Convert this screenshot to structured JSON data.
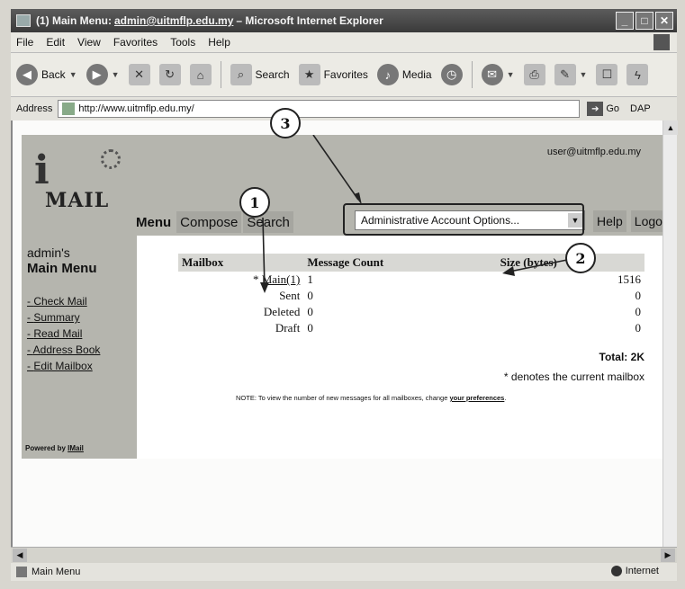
{
  "window": {
    "title_prefix": "(1) Main Menu: ",
    "title_email": "admin@uitmflp.edu.my",
    "title_suffix": "– Microsoft Internet Explorer"
  },
  "menubar": [
    "File",
    "Edit",
    "View",
    "Favorites",
    "Tools",
    "Help"
  ],
  "toolbar": {
    "back": "Back",
    "search": "Search",
    "favorites": "Favorites",
    "media": "Media"
  },
  "address": {
    "label": "Address",
    "url": "http://www.uitmflp.edu.my/",
    "go": "Go",
    "links": "DAP"
  },
  "mail": {
    "logo": "MAIL",
    "user_email": "user@uitmflp.edu.my",
    "tabs": [
      "Menu",
      "Compose",
      "Search"
    ],
    "account_select": "Administrative Account Options...",
    "help": "Help",
    "logout": "Logout",
    "sidebar": {
      "title_line1": "admin's",
      "title_line2": "Main Menu",
      "links": [
        "Check Mail",
        "Summary",
        "Read Mail",
        "Address Book",
        "Edit Mailbox"
      ],
      "powered_by_prefix": "Powered by ",
      "powered_by_link": "IMail"
    },
    "table": {
      "headers": [
        "Mailbox",
        "Message Count",
        "Size (bytes)"
      ],
      "rows": [
        {
          "mailbox": "Main(1)",
          "marker": "*",
          "count": "1",
          "size": "1516"
        },
        {
          "mailbox": "Sent",
          "marker": "",
          "count": "0",
          "size": "0"
        },
        {
          "mailbox": "Deleted",
          "marker": "",
          "count": "0",
          "size": "0"
        },
        {
          "mailbox": "Draft",
          "marker": "",
          "count": "0",
          "size": "0"
        }
      ]
    },
    "total_label": "Total:",
    "total_value": "2K",
    "denote": "* denotes the current mailbox",
    "note_text": "NOTE: To view the number of new messages for all mailboxes, change ",
    "note_link": "your preferences",
    "note_end": "."
  },
  "callouts": [
    "1",
    "2",
    "3"
  ],
  "status": {
    "text": "Main Menu",
    "zone": "Internet"
  }
}
